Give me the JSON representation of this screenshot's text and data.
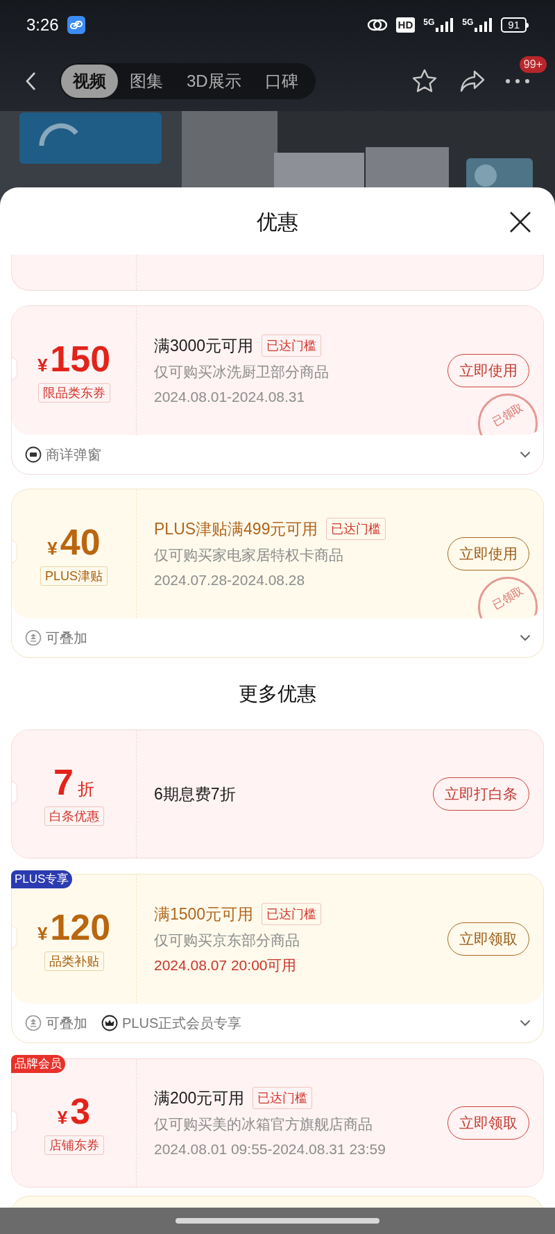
{
  "status_bar": {
    "time": "3:26",
    "hd": "HD",
    "network_1": "5G",
    "network_2": "5G",
    "battery": "91"
  },
  "nav": {
    "tabs": [
      {
        "label": "视频",
        "selected": true
      },
      {
        "label": "图集",
        "selected": false
      },
      {
        "label": "3D展示",
        "selected": false
      },
      {
        "label": "口碑",
        "selected": false
      }
    ],
    "more_badge": "99+"
  },
  "sheet": {
    "title": "优惠"
  },
  "coupons": [
    {
      "kind": "red",
      "prefix": "¥",
      "amount": "150",
      "type_tag": "限品类东券",
      "title": "满3000元可用",
      "threshold": "已达门槛",
      "scope": "仅可购买冰洗厨卫部分商品",
      "validity": "2024.08.01-2024.08.31",
      "validity_alert": false,
      "button": "立即使用",
      "stamp": "已领取",
      "footer": {
        "items": [
          {
            "kind": "popup",
            "text": "商详弹窗"
          }
        ],
        "expanded": false
      }
    },
    {
      "kind": "gold",
      "prefix": "¥",
      "amount": "40",
      "type_tag": "PLUS津贴",
      "title": "PLUS津贴满499元可用",
      "threshold": "已达门槛",
      "scope": "仅可购买家电家居特权卡商品",
      "validity": "2024.07.28-2024.08.28",
      "validity_alert": false,
      "button": "立即使用",
      "stamp": "已领取",
      "footer": {
        "items": [
          {
            "kind": "stack",
            "text": "可叠加"
          }
        ],
        "expanded": false
      }
    }
  ],
  "more_section": {
    "title": "更多优惠"
  },
  "more_coupons": [
    {
      "kind": "red",
      "amount": "7",
      "suffix": "折",
      "type_tag": "白条优惠",
      "title": "6期息费7折",
      "button": "立即打白条"
    },
    {
      "kind": "gold",
      "badge": {
        "text": "PLUS专享",
        "color": "#2b3bb0"
      },
      "prefix": "¥",
      "amount": "120",
      "type_tag": "品类补贴",
      "title": "满1500元可用",
      "threshold": "已达门槛",
      "scope": "仅可购买京东部分商品",
      "validity": "2024.08.07 20:00可用",
      "validity_alert": true,
      "button": "立即领取",
      "footer": {
        "items": [
          {
            "kind": "stack",
            "text": "可叠加"
          },
          {
            "kind": "crown",
            "text": "PLUS正式会员专享"
          }
        ],
        "expanded": false
      }
    },
    {
      "kind": "red",
      "badge": {
        "text": "品牌会员",
        "color": "#e8312a"
      },
      "prefix": "¥",
      "amount": "3",
      "type_tag": "店铺东券",
      "title": "满200元可用",
      "threshold": "已达门槛",
      "scope": "仅可购买美的冰箱官方旗舰店商品",
      "validity": "2024.08.01 09:55-2024.08.31 23:59",
      "validity_alert": false,
      "button": "立即领取"
    }
  ]
}
